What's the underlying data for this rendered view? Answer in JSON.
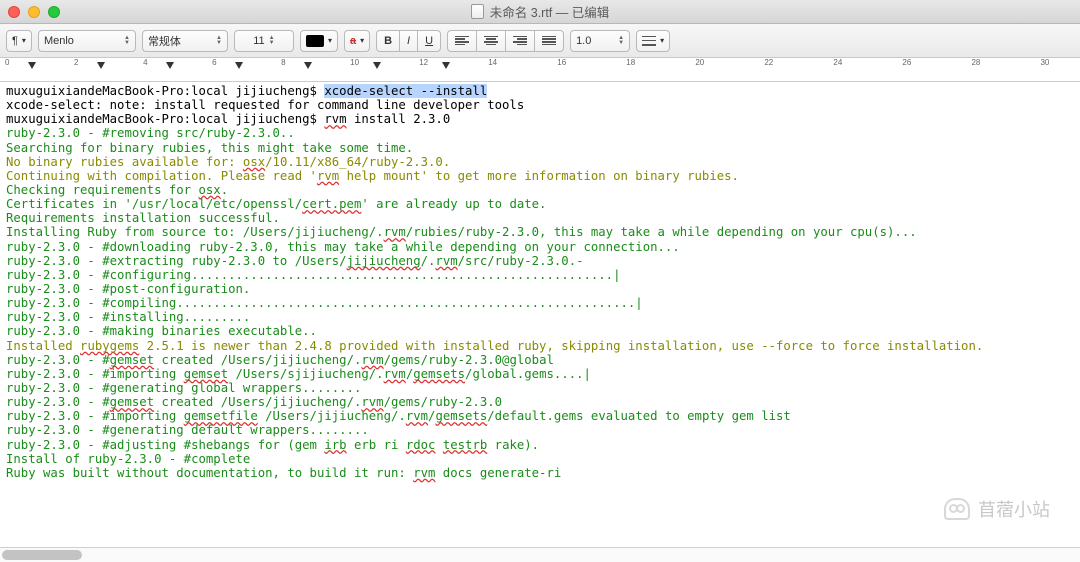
{
  "window": {
    "title": "未命名 3.rtf — 已编辑"
  },
  "toolbar": {
    "paragraph_btn": "¶",
    "font": "Menlo",
    "style": "常规体",
    "size": "11",
    "bold": "B",
    "italic": "I",
    "underline": "U",
    "spacing": "1.0",
    "strike_char": "a"
  },
  "ruler": {
    "ticks": [
      "0",
      "2",
      "4",
      "6",
      "8",
      "10",
      "12",
      "14",
      "16",
      "18",
      "20",
      "22",
      "24",
      "26",
      "28",
      "30"
    ]
  },
  "terminal": {
    "line1_prompt": "muxuguixiandeMacBook-Pro:local jijiucheng$ ",
    "line1_cmd": "xcode-select --install",
    "line2": "xcode-select: note: install requested for command line developer tools",
    "line3_prompt": "muxuguixiandeMacBook-Pro:local jijiucheng$ ",
    "line3_cmd_a": "rvm",
    "line3_cmd_b": " install 2.3.0",
    "l4": "ruby-2.3.0 - #removing src/ruby-2.3.0..",
    "l5": "Searching for binary rubies, this might take some time.",
    "l6a": "No binary rubies available for: ",
    "l6b": "osx",
    "l6c": "/10.11/x86_64/ruby-2.3.0.",
    "l7a": "Continuing with compilation. Please read '",
    "l7b": "rvm",
    "l7c": " help mount' to get more information on binary rubies.",
    "l8a": "Checking requirements for ",
    "l8b": "osx",
    "l8c": ".",
    "l9a": "Certificates in '/usr/local/etc/openssl/",
    "l9b": "cert.pem",
    "l9c": "' are already up to date.",
    "l10": "Requirements installation successful.",
    "l11a": "Installing Ruby from source to: /Users/jijiucheng/.",
    "l11b": "rvm",
    "l11c": "/rubies/ruby-2.3.0, this may take a while depending on your cpu(s)...",
    "l12": "ruby-2.3.0 - #downloading ruby-2.3.0, this may take a while depending on your connection...",
    "l13a": "ruby-2.3.0 - #extracting ruby-2.3.0 to /Users/",
    "l13b": "jijiucheng",
    "l13c": "/.",
    "l13d": "rvm",
    "l13e": "/src/ruby-2.3.0.-",
    "l14": "ruby-2.3.0 - #configuring.........................................................|",
    "l15": "ruby-2.3.0 - #post-configuration.",
    "l16": "ruby-2.3.0 - #compiling..............................................................|",
    "l17": "ruby-2.3.0 - #installing.........",
    "l18": "ruby-2.3.0 - #making binaries executable..",
    "l19a": "Installed ",
    "l19b": "rubygems",
    "l19c": " 2.5.1 is newer than 2.4.8 provided with installed ruby, skipping installation, use --force to force installation.",
    "l20a": "ruby-2.3.0 - #",
    "l20b": "gemset",
    "l20c": " created /Users/jijiucheng/.",
    "l20d": "rvm",
    "l20e": "/gems/ruby-2.3.0@global",
    "l21a": "ruby-2.3.0 - #importing ",
    "l21b": "gemset",
    "l21c": " /Users/sjijiucheng/.",
    "l21d": "rvm",
    "l21e": "/",
    "l21f": "gemsets",
    "l21g": "/global.gems....|",
    "l22": "ruby-2.3.0 - #generating global wrappers........",
    "l23a": "ruby-2.3.0 - #",
    "l23b": "gemset",
    "l23c": " created /Users/jijiucheng/.",
    "l23d": "rvm",
    "l23e": "/gems/ruby-2.3.0",
    "l24a": "ruby-2.3.0 - #importing ",
    "l24b": "gemsetfile",
    "l24c": " /Users/jijiucheng/.",
    "l24d": "rvm",
    "l24e": "/",
    "l24f": "gemsets",
    "l24g": "/default.gems evaluated to empty gem list",
    "l25": "ruby-2.3.0 - #generating default wrappers........",
    "l26a": "ruby-2.3.0 - #adjusting #shebangs for (gem ",
    "l26b": "irb",
    "l26c": " erb ri ",
    "l26d": "rdoc",
    "l26e": " ",
    "l26f": "testrb",
    "l26g": " rake).",
    "l27": "Install of ruby-2.3.0 - #complete",
    "l28a": "Ruby was built without documentation, to build it run: ",
    "l28b": "rvm",
    "l28c": " docs generate-ri"
  },
  "watermark": "苜蓿小站"
}
